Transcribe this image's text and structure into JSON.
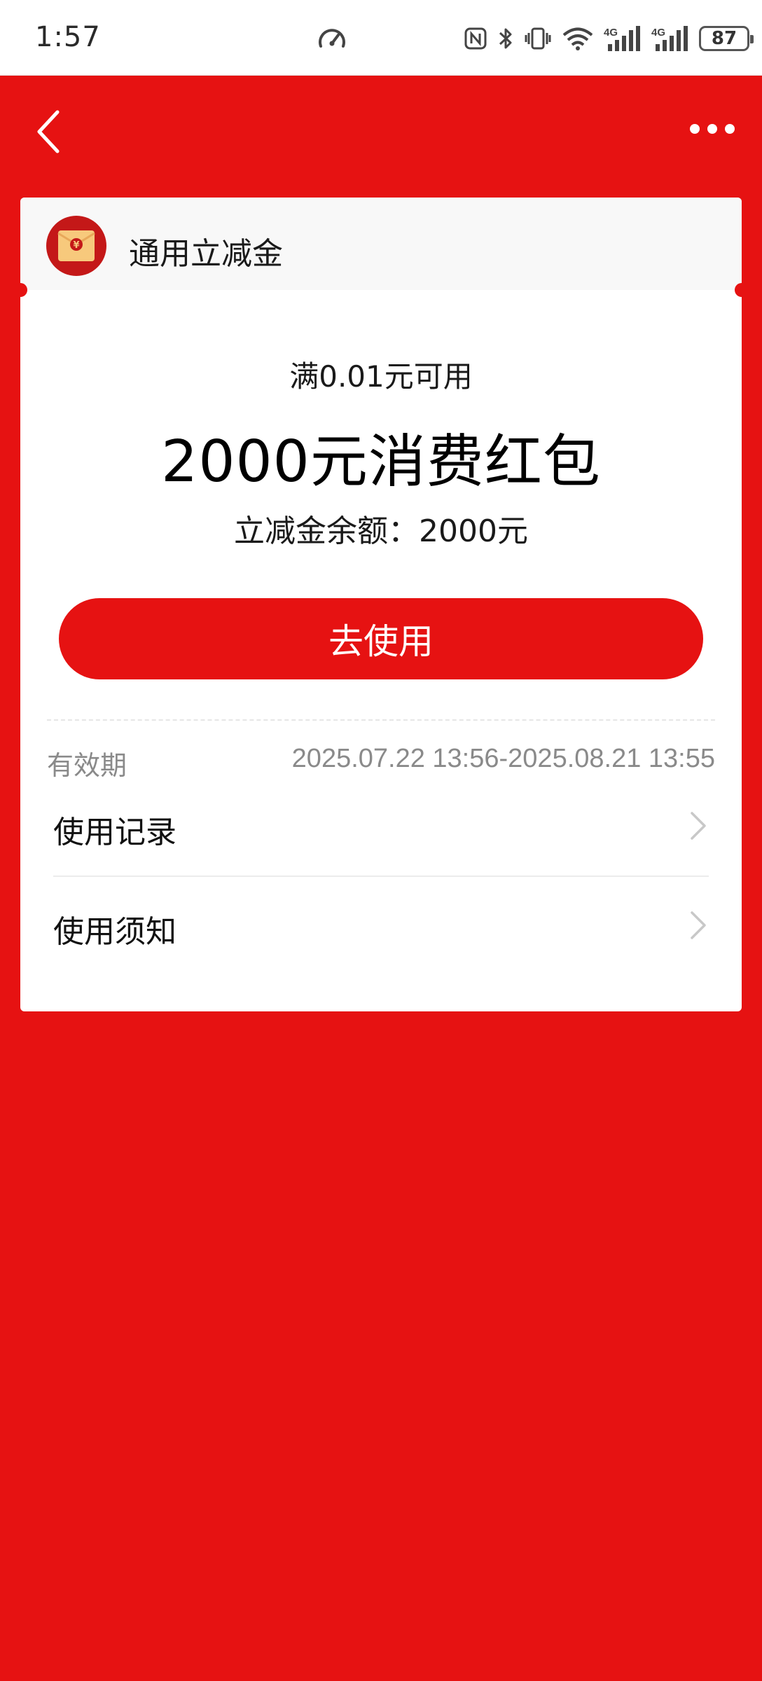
{
  "status_bar": {
    "time": "1:57",
    "icons": [
      "speedometer-icon",
      "nfc-icon",
      "bluetooth-icon",
      "vibrate-icon",
      "wifi-icon",
      "signal-4g-icon",
      "signal-4g-icon"
    ],
    "signal_label_1": "4G",
    "signal_label_2": "4G",
    "battery": "87"
  },
  "nav": {
    "back_icon": "chevron-left-icon",
    "more_icon": "more-dots-icon"
  },
  "card": {
    "title": "通用立减金",
    "logo_icon": "red-envelope-icon",
    "logo_symbol": "¥",
    "threshold": "满0.01元可用",
    "amount_title": "2000元消费红包",
    "balance": "立减金余额：2000元",
    "use_button": "去使用",
    "validity_label": "有效期",
    "validity_value": "2025.07.22 13:56-2025.08.21 13:55",
    "rows": [
      {
        "label": "使用记录",
        "icon": "chevron-right-icon"
      },
      {
        "label": "使用须知",
        "icon": "chevron-right-icon"
      }
    ]
  },
  "colors": {
    "brand_red": "#e61212",
    "logo_envelope": "#f7c97c"
  }
}
